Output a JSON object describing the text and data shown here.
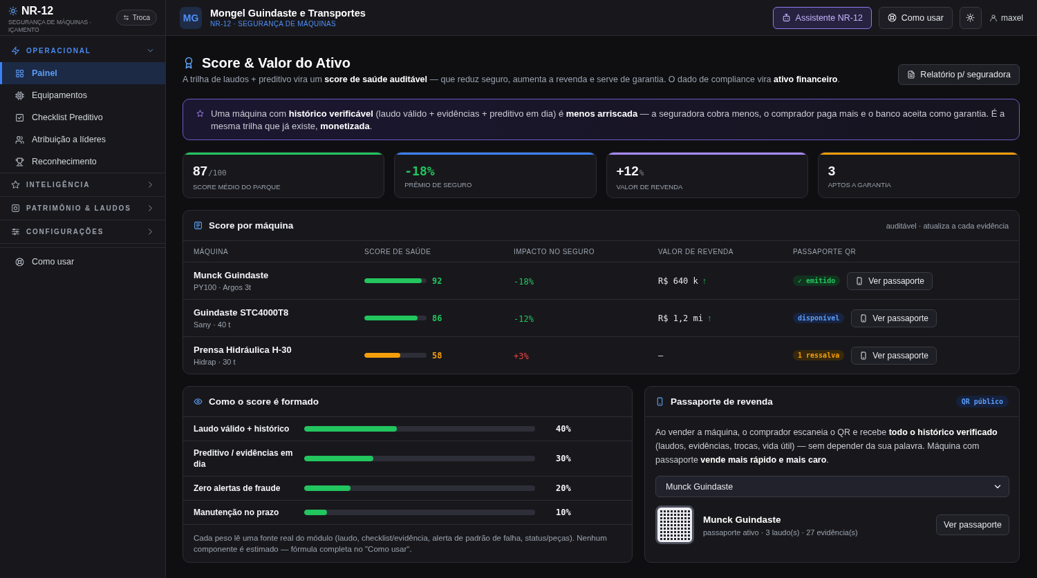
{
  "sidebar": {
    "brand": {
      "title": "NR-12",
      "subtitle": "SEGURANÇA DE MÁQUINAS · IÇAMENTO"
    },
    "switch_button": "Troca",
    "groups": [
      {
        "label": "OPERACIONAL",
        "expanded": true,
        "items": [
          {
            "label": "Painel",
            "selected": true
          },
          {
            "label": "Equipamentos",
            "selected": false
          },
          {
            "label": "Checklist Preditivo",
            "selected": false
          },
          {
            "label": "Atribuição a líderes",
            "selected": false
          },
          {
            "label": "Reconhecimento",
            "selected": false
          }
        ]
      },
      {
        "label": "INTELIGÊNCIA",
        "expanded": false
      },
      {
        "label": "PATRIMÔNIO & LAUDOS",
        "expanded": false
      },
      {
        "label": "CONFIGURAÇÕES",
        "expanded": false
      }
    ],
    "footer_items": [
      {
        "label": "Como usar",
        "selected": false
      }
    ]
  },
  "header": {
    "avatar": "MG",
    "company": "Mongel Guindaste e Transportes",
    "subtitle": "NR-12 · SEGURANÇA DE MÁQUINAS",
    "actions": [
      {
        "label": "Assistente NR-12",
        "kind": "assistant"
      },
      {
        "label": "Como usar",
        "kind": "help"
      },
      {
        "kind": "theme"
      }
    ],
    "user": "maxel"
  },
  "page": {
    "title": "Score & Valor do Ativo",
    "subtitle": "A trilha de laudos + preditivo vira um **score de saúde auditável** — que reduz seguro, aumenta a revenda e serve de garantia. O dado de compliance vira **ativo financeiro**.",
    "report_button": "Relatório p/ seguradora"
  },
  "banner": {
    "text": "Uma máquina com **histórico verificável** (laudo válido + evidências + preditivo em dia) é **menos arriscada** — a seguradora cobra menos, o comprador paga mais e o banco aceita como garantia. É a mesma trilha que já existe, **monetizada**."
  },
  "kpis": [
    {
      "value": "87",
      "unit": "/100",
      "label": "SCORE MÉDIO DO PARQUE",
      "color": "#22c55e",
      "kind": "count"
    },
    {
      "value": "-18%",
      "label": "PRÊMIO DE SEGURO",
      "color": "#3b82f6",
      "kind": "delta"
    },
    {
      "value": "+12",
      "unit": "%",
      "label": "VALOR DE REVENDA",
      "color": "#a78bfa",
      "kind": "count"
    },
    {
      "value": "3",
      "label": "APTOS A GARANTIA",
      "color": "#f59e0b",
      "kind": "count"
    }
  ],
  "score_table": {
    "title": "Score por máquina",
    "note": "auditável · atualiza a cada evidência",
    "columns": [
      "MÁQUINA",
      "SCORE DE SAÚDE",
      "IMPACTO NO SEGURO",
      "VALOR DE REVENDA",
      "PASSAPORTE QR"
    ],
    "rows": [
      {
        "name": "Munck Guindaste",
        "detail": "PY100 · Argos 3t",
        "score": {
          "value": "92",
          "level": 0.92,
          "color": "#22c55e"
        },
        "impact": {
          "value": "-18%",
          "color": "#22c55e"
        },
        "resale": "R$ 640 k",
        "trend": "↑",
        "passport": {
          "label": "✓ emitido",
          "kind": "issued"
        },
        "action": "Ver passaporte"
      },
      {
        "name": "Guindaste STC4000T8",
        "detail": "Sany · 40 t",
        "score": {
          "value": "86",
          "level": 0.86,
          "color": "#22c55e"
        },
        "impact": {
          "value": "-12%",
          "color": "#22c55e"
        },
        "resale": "R$ 1,2 mi",
        "trend": "↑",
        "passport": {
          "label": "disponível",
          "kind": "available"
        },
        "action": "Ver passaporte"
      },
      {
        "name": "Prensa Hidráulica H-30",
        "detail": "Hidrap · 30 t",
        "score": {
          "value": "58",
          "level": 0.58,
          "color": "#f59e0b"
        },
        "impact": {
          "value": "+3%",
          "color": "#ef4444"
        },
        "resale": "—",
        "passport": {
          "label": "1 ressalva",
          "kind": "caveat"
        },
        "action": "Ver passaporte"
      }
    ]
  },
  "formula": {
    "title": "Como o score é formado",
    "factors": [
      {
        "label": "Laudo válido + histórico",
        "level": 0.4,
        "weight": "40%"
      },
      {
        "label": "Preditivo / evidências em dia",
        "level": 0.3,
        "weight": "30%"
      },
      {
        "label": "Zero alertas de fraude",
        "level": 0.2,
        "weight": "20%"
      },
      {
        "label": "Manutenção no prazo",
        "level": 0.1,
        "weight": "10%"
      }
    ],
    "footnote": "Cada peso lê uma fonte real do módulo (laudo, checklist/evidência, alerta de padrão de falha, status/peças). Nenhum componente é estimado — fórmula completa no \"Como usar\"."
  },
  "passport": {
    "title": "Passaporte de revenda",
    "badge": "QR público",
    "text": "Ao vender a máquina, o comprador escaneia o QR e recebe **todo o histórico verificado** (laudos, evidências, trocas, vida útil) — sem depender da sua palavra. Máquina com passaporte **vende mais rápido e mais caro**.",
    "select_value": "Munck Guindaste",
    "machine": "Munck Guindaste",
    "meta": "passaporte ativo · 3 laudo(s) · 27 evidência(s)",
    "button": "Ver passaporte"
  }
}
